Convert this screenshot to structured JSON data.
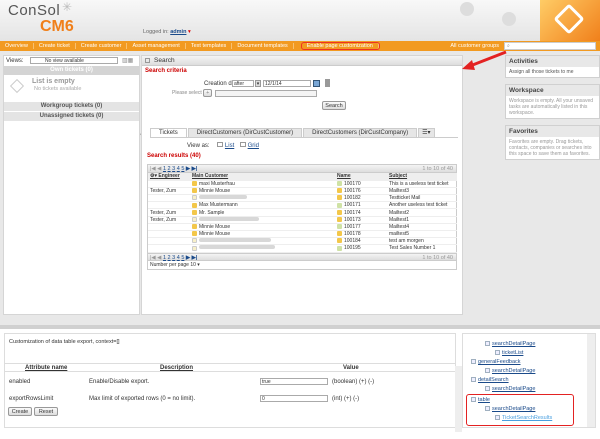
{
  "header": {
    "logo_top": "ConSol",
    "logo_bottom_a": "CM",
    "logo_bottom_b": "6",
    "logged_prefix": "Logged in:",
    "user": "admin",
    "user_marker": "▾"
  },
  "nav": {
    "items": [
      "Overview",
      "Create ticket",
      "Create customer",
      "Asset management",
      "Text templates",
      "Document templates",
      "Enable page customization"
    ],
    "right_item": "All customer groups"
  },
  "left": {
    "views_label": "Views:",
    "views_value": "No view available",
    "own_tickets": "Own tickets (0)",
    "empty_title": "List is empty",
    "empty_sub": "No tickets available",
    "workgroup": "Workgroup tickets (0)",
    "unassigned": "Unassigned tickets (0)"
  },
  "search": {
    "title": "Search",
    "criteria": "Search criteria",
    "creation_date_label": "Creation date",
    "date_op": "after",
    "date_value": "12/1/14",
    "please_select": "Please select",
    "search_button": "Search",
    "tabs": [
      "Tickets",
      "DirectCustomers (DirCustCustomer)",
      "DirectCustomers (DirCustCompany)"
    ],
    "view_as_label": "View as:",
    "view_list": "List",
    "view_grid": "Grid",
    "results_label": "Search results (40)",
    "pager_pages": [
      "1",
      "2",
      "3",
      "4",
      "5"
    ],
    "pager_range": "1 to 10 of 40",
    "pager_range_bottom": "1 to 10 of 40",
    "per_page_label": "Number per page",
    "per_page_value": "10",
    "columns": [
      "Engineer",
      "Main Customer",
      "Name",
      "Subject"
    ],
    "rows": [
      {
        "engineer": "",
        "customer": "maxi Musterfrau",
        "name": "100170",
        "subject": "This is a useless test ticket",
        "blur": false
      },
      {
        "engineer": "Tester, Zum",
        "customer": "Minnie Mouse",
        "name": "100176",
        "subject": "Mailtest3",
        "blur": false
      },
      {
        "engineer": "",
        "customer": "",
        "name": "100182",
        "subject": "Testticket Mail",
        "blur": true
      },
      {
        "engineer": "",
        "customer": "Max Mustermann",
        "name": "100171",
        "subject": "Another useless test ticket",
        "blur": false
      },
      {
        "engineer": "Tester, Zum",
        "customer": "Mr. Sample",
        "name": "100174",
        "subject": "Mailtest2",
        "blur": false
      },
      {
        "engineer": "Tester, Zum",
        "customer": "",
        "name": "100173",
        "subject": "Mailtest1",
        "blur": true
      },
      {
        "engineer": "",
        "customer": "Minnie Mouse",
        "name": "100177",
        "subject": "Mailtest4",
        "blur": false
      },
      {
        "engineer": "",
        "customer": "Minnie Mouse",
        "name": "100178",
        "subject": "mailtest5",
        "blur": false
      },
      {
        "engineer": "",
        "customer": "",
        "name": "100184",
        "subject": "test am morgen",
        "blur": true
      },
      {
        "engineer": "",
        "customer": "",
        "name": "100195",
        "subject": "Test Sales Number 1",
        "blur": true
      }
    ]
  },
  "right": {
    "activities_title": "Activities",
    "activities_link": "Assign all those tickets to me",
    "workspace_title": "Workspace",
    "workspace_text": "Workspace is empty. All your unsaved tasks are automatically listed in this workspace.",
    "favorites_title": "Favorites",
    "favorites_text": "Favorites are empty. Drag tickets, contacts, companies or searches into this space to save them as favorites."
  },
  "customization": {
    "context_label": "Customization of data table export, context=[]",
    "headers": [
      "Attribute name",
      "Description",
      "Value"
    ],
    "rows": [
      {
        "attr": "enabled",
        "desc": "Enable/Disable export.",
        "value": "true",
        "type": "(boolean) (+) (-)"
      },
      {
        "attr": "exportRowsLimit",
        "desc": "Max limit of exported rows (0 = no limit).",
        "value": "0",
        "type": "(int) (+) (-)"
      }
    ],
    "create_button": "Create",
    "reset_button": "Reset"
  },
  "tree": {
    "nodes": [
      "searchDetailPage",
      "ticketList",
      "generalFeedback",
      "searchDetailPage",
      "detailSearch",
      "searchDetailPage",
      "table",
      "searchDetailPage",
      "TicketSearchResults"
    ]
  },
  "colors": {
    "accent": "#f29a21",
    "highlight": "#e32222",
    "link": "#1a4a8a"
  }
}
